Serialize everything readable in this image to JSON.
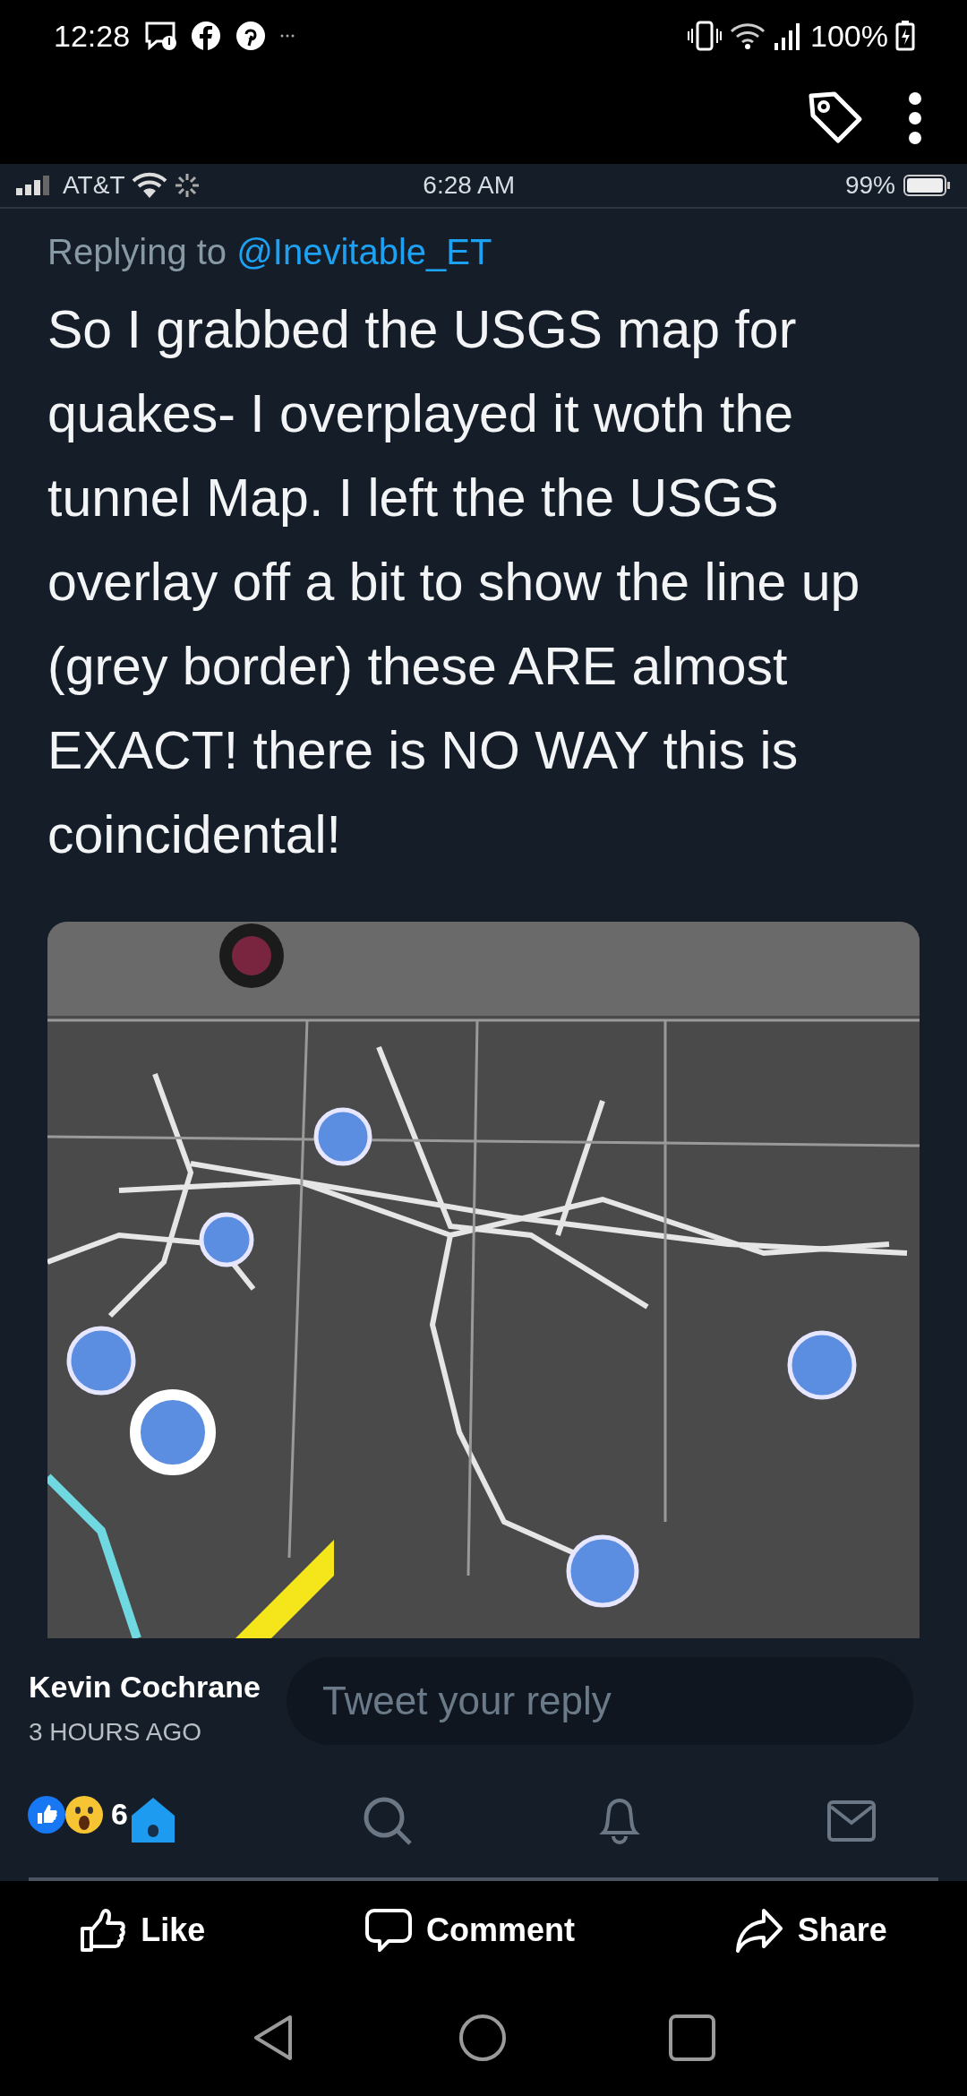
{
  "status_bar": {
    "time": "12:28",
    "battery": "100%"
  },
  "inner_status_bar": {
    "carrier": "AT&T",
    "time": "6:28 AM",
    "battery": "99%"
  },
  "tweet": {
    "replying_label": "Replying to",
    "handle": "@Inevitable_ET",
    "text": "So I grabbed the USGS map for quakes- I overplayed it woth the tunnel Map. I left the the USGS overlay off a bit to show the line up (grey border) these ARE almost EXACT! there is NO WAY this is coincidental!"
  },
  "reply_field": {
    "placeholder": "Tweet your reply"
  },
  "post": {
    "author": "Kevin Cochrane",
    "time": "3 HOURS AGO",
    "reaction_count": "6"
  },
  "actions": [
    {
      "kind": "like",
      "label": "Like"
    },
    {
      "kind": "comment",
      "label": "Comment"
    },
    {
      "kind": "share",
      "label": "Share"
    }
  ]
}
